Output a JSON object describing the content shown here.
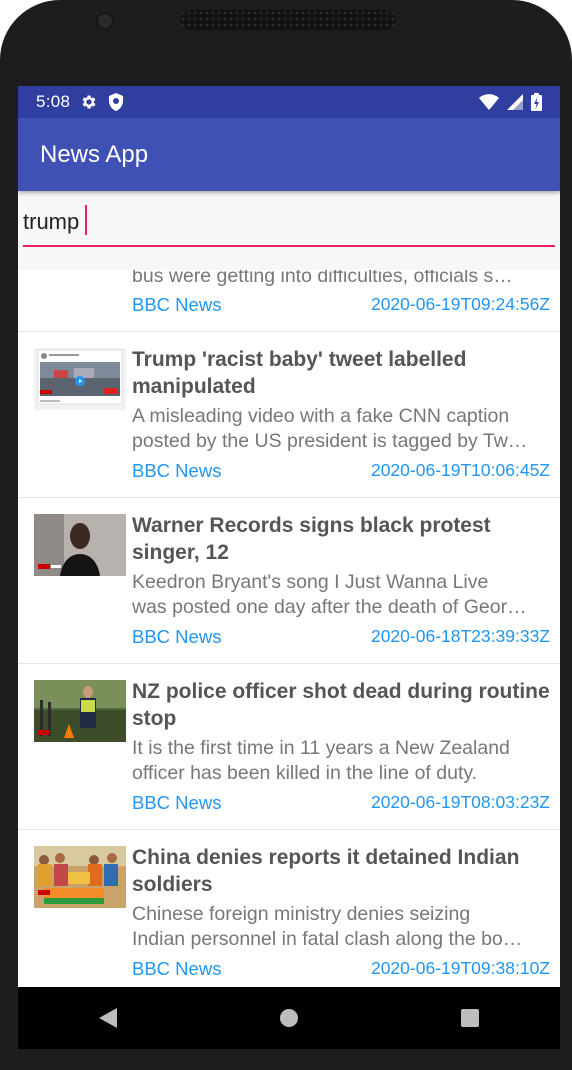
{
  "status_bar": {
    "time": "5:08",
    "icons": [
      "gear-icon",
      "shield-icon",
      "wifi-icon",
      "signal-icon",
      "battery-icon"
    ]
  },
  "app_bar": {
    "title": "News App"
  },
  "search": {
    "value": "trump",
    "accent_color": "#e91e63"
  },
  "colors": {
    "primary": "#3f51b5",
    "primary_dark": "#303f9f",
    "link": "#2196f3"
  },
  "articles": [
    {
      "title": "",
      "description_line2": "bus were getting into difficulties, officials s…",
      "source": "BBC News",
      "published": "2020-06-19T09:24:56Z"
    },
    {
      "title": "Trump 'racist baby' tweet labelled manipulated",
      "description_line1": "A misleading video with a fake CNN caption",
      "description_line2": "posted by the US president is tagged by Tw…",
      "source": "BBC News",
      "published": "2020-06-19T10:06:45Z"
    },
    {
      "title": "Warner Records signs black protest singer, 12",
      "description_line1": "Keedron Bryant's song I Just Wanna Live",
      "description_line2": "was posted one day after the death of Geor…",
      "source": "BBC News",
      "published": "2020-06-18T23:39:33Z"
    },
    {
      "title": "NZ police officer shot dead during routine stop",
      "description_line1": "It is the first time in 11 years a New Zealand",
      "description_line2": "officer has been killed in the line of duty.",
      "source": "BBC News",
      "published": "2020-06-19T08:03:23Z"
    },
    {
      "title": "China denies reports it detained Indian soldiers",
      "description_line1": "Chinese foreign ministry denies seizing",
      "description_line2": "Indian personnel in fatal clash along the bo…",
      "source": "BBC News",
      "published": "2020-06-19T09:38:10Z"
    }
  ],
  "nav_bar": {
    "buttons": [
      "back-icon",
      "home-icon",
      "recents-icon"
    ]
  }
}
